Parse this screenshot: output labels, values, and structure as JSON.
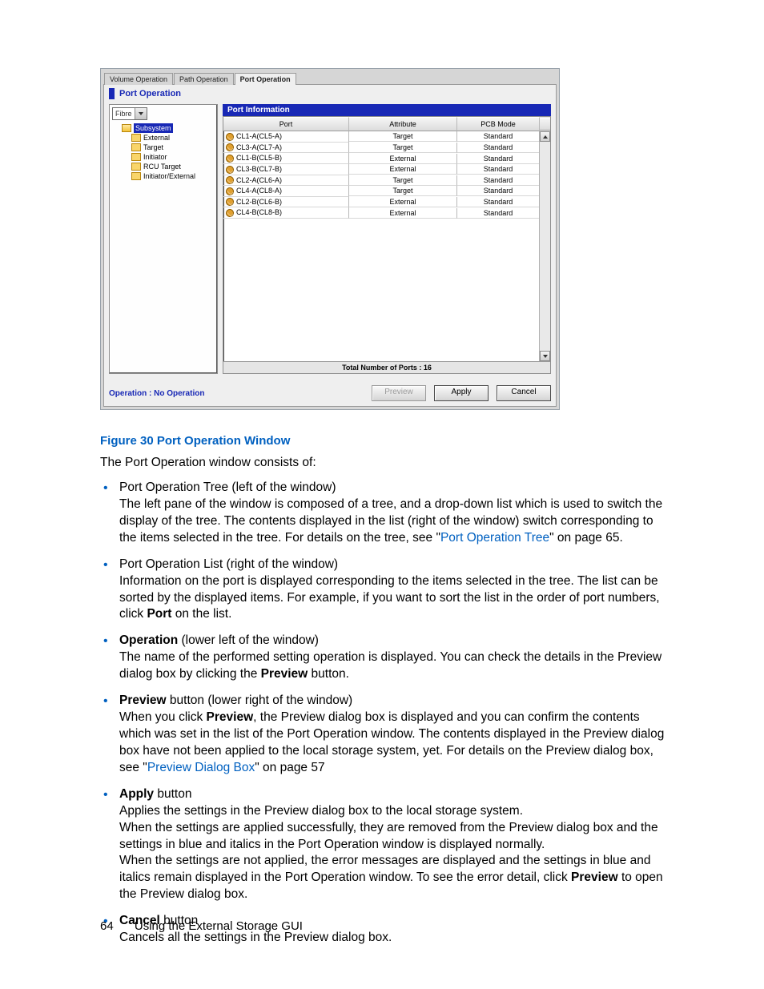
{
  "tabs": {
    "t1": "Volume Operation",
    "t2": "Path Operation",
    "t3": "Port Operation"
  },
  "section_title": "Port Operation",
  "dropdown": "Fibre",
  "tree": {
    "root": "Subsystem",
    "items": [
      "External",
      "Target",
      "Initiator",
      "RCU Target",
      "Initiator/External"
    ]
  },
  "right_header": "Port Information",
  "columns": {
    "port": "Port",
    "attr": "Attribute",
    "pcb": "PCB Mode"
  },
  "rows": [
    {
      "port": "CL1-A(CL5-A)",
      "attr": "Target",
      "pcb": "Standard"
    },
    {
      "port": "CL3-A(CL7-A)",
      "attr": "Target",
      "pcb": "Standard"
    },
    {
      "port": "CL1-B(CL5-B)",
      "attr": "External",
      "pcb": "Standard"
    },
    {
      "port": "CL3-B(CL7-B)",
      "attr": "External",
      "pcb": "Standard"
    },
    {
      "port": "CL2-A(CL6-A)",
      "attr": "Target",
      "pcb": "Standard"
    },
    {
      "port": "CL4-A(CL8-A)",
      "attr": "Target",
      "pcb": "Standard"
    },
    {
      "port": "CL2-B(CL6-B)",
      "attr": "External",
      "pcb": "Standard"
    },
    {
      "port": "CL4-B(CL8-B)",
      "attr": "External",
      "pcb": "Standard"
    }
  ],
  "total_ports": "Total Number of Ports : 16",
  "operation_status": "Operation : No Operation",
  "buttons": {
    "preview": "Preview",
    "apply": "Apply",
    "cancel": "Cancel"
  },
  "figure_caption": "Figure 30 Port Operation Window",
  "intro": "The Port Operation window consists of:",
  "b1_title": "Port Operation Tree (left of the window)",
  "b1_l1": "The left pane of the window is composed of a tree, and a drop-down list which is used to switch the display of the tree. The contents displayed in the list (right of the window) switch corresponding to the items selected in the tree. For details on the tree, see \"",
  "b1_link": "Port Operation Tree",
  "b1_l2": "\" on page 65.",
  "b2_title": "Port Operation List (right of the window)",
  "b2_l1": "Information on the port is displayed corresponding to the items selected in the tree. The list can be sorted by the displayed items. For example, if you want to sort the list in the order of port numbers, click ",
  "b2_bold": "Port",
  "b2_l2": " on the list.",
  "b3_bold": "Operation",
  "b3_tail": " (lower left of the window)",
  "b3_l1": "The name of the performed setting operation is displayed. You can check the details in the Preview dialog box by clicking the ",
  "b3_bold2": "Preview",
  "b3_l2": " button.",
  "b4_bold": "Preview",
  "b4_tail": " button (lower right of the window)",
  "b4_l1": "When you click ",
  "b4_bold2": "Preview",
  "b4_l2": ", the Preview dialog box is displayed and you can confirm the contents which was set in the list of the Port Operation window. The contents displayed in the Preview dialog box have not been applied to the local storage system, yet. For details on the Preview dialog box, see \"",
  "b4_link": "Preview Dialog Box",
  "b4_l3": "\" on page 57",
  "b5_bold": "Apply",
  "b5_tail": " button",
  "b5_l1": "Applies the settings in the Preview dialog box to the local storage system.",
  "b5_l2": "When the settings are applied successfully, they are removed from the Preview dialog box and the settings in blue and italics in the Port Operation window is displayed normally.",
  "b5_l3a": "When the settings are not applied, the error messages are displayed and the settings in blue and italics remain displayed in the Port Operation window. To see the error detail, click ",
  "b5_l3bold": "Preview",
  "b5_l3b": " to open the Preview dialog box.",
  "b6_bold": "Cancel",
  "b6_tail": " button",
  "b6_l1": "Cancels all the settings in the Preview dialog box.",
  "page_number": "64",
  "page_footer": "Using the External Storage GUI"
}
